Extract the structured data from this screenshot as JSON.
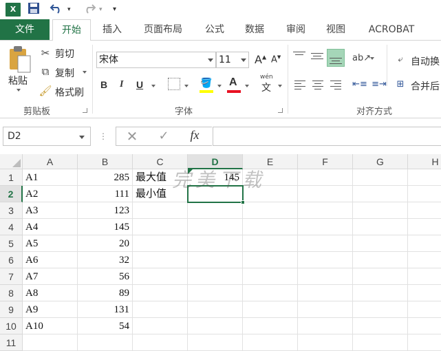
{
  "titlebar": {
    "app_icon": "X",
    "undo_icon": "undo-icon",
    "redo_icon": "redo-icon",
    "save_icon": "save-icon"
  },
  "tabs": [
    {
      "label": "文件"
    },
    {
      "label": "开始"
    },
    {
      "label": "插入"
    },
    {
      "label": "页面布局"
    },
    {
      "label": "公式"
    },
    {
      "label": "数据"
    },
    {
      "label": "审阅"
    },
    {
      "label": "视图"
    },
    {
      "label": "ACROBAT"
    }
  ],
  "ribbon": {
    "clipboard": {
      "paste": "粘贴",
      "cut": "剪切",
      "copy": "复制",
      "format_painter": "格式刷",
      "group": "剪贴板"
    },
    "font": {
      "name": "宋体",
      "size": "11",
      "bold": "B",
      "italic": "I",
      "underline": "U",
      "grow": "A",
      "shrink": "A",
      "pinyin": "wén",
      "pinyin2": "文",
      "group": "字体",
      "font_color": "A"
    },
    "alignment": {
      "wrap": "自动换",
      "merge": "合并后",
      "group": "对齐方式"
    }
  },
  "formula_bar": {
    "name_box": "D2",
    "fx": "fx",
    "formula": ""
  },
  "columns": [
    "A",
    "B",
    "C",
    "D",
    "E",
    "F",
    "G",
    "H"
  ],
  "rows": [
    {
      "num": "1",
      "a": "A1",
      "b": "285",
      "c": "最大值",
      "d": "145"
    },
    {
      "num": "2",
      "a": "A2",
      "b": "111",
      "c": "最小值",
      "d": ""
    },
    {
      "num": "3",
      "a": "A3",
      "b": "123",
      "c": "",
      "d": ""
    },
    {
      "num": "4",
      "a": "A4",
      "b": "145",
      "c": "",
      "d": ""
    },
    {
      "num": "5",
      "a": "A5",
      "b": "20",
      "c": "",
      "d": ""
    },
    {
      "num": "6",
      "a": "A6",
      "b": "32",
      "c": "",
      "d": ""
    },
    {
      "num": "7",
      "a": "A7",
      "b": "56",
      "c": "",
      "d": ""
    },
    {
      "num": "8",
      "a": "A8",
      "b": "89",
      "c": "",
      "d": ""
    },
    {
      "num": "9",
      "a": "A9",
      "b": "131",
      "c": "",
      "d": ""
    },
    {
      "num": "10",
      "a": "A10",
      "b": "54",
      "c": "",
      "d": ""
    },
    {
      "num": "11",
      "a": "",
      "b": "",
      "c": "",
      "d": ""
    }
  ],
  "selected": {
    "col": "D",
    "row": "2"
  },
  "watermark": "完美下载",
  "colors": {
    "accent": "#217346",
    "font_color_bar": "#e81123",
    "highlight_bar": "#ffff00"
  }
}
